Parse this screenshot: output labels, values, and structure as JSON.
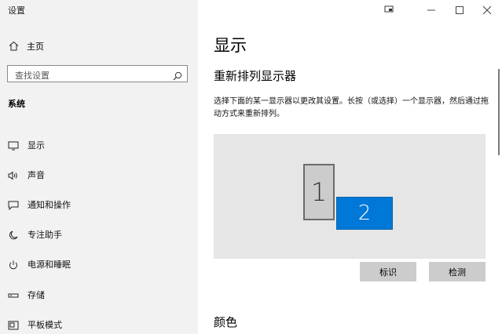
{
  "window": {
    "title": "设置"
  },
  "sidebar": {
    "home_label": "主页",
    "search_placeholder": "查找设置",
    "section_title": "系统",
    "items": [
      {
        "label": "显示",
        "icon": "monitor-icon"
      },
      {
        "label": "声音",
        "icon": "speaker-icon"
      },
      {
        "label": "通知和操作",
        "icon": "notification-icon"
      },
      {
        "label": "专注助手",
        "icon": "moon-icon"
      },
      {
        "label": "电源和睡眠",
        "icon": "power-icon"
      },
      {
        "label": "存储",
        "icon": "storage-icon"
      },
      {
        "label": "平板模式",
        "icon": "tablet-mode-icon"
      }
    ]
  },
  "main": {
    "title": "显示",
    "subheading": "重新排列显示器",
    "description": "选择下面的某一显示器以更改其设置。长按（或选择）一个显示器，然后通过拖动方式来重新排列。",
    "monitors": [
      {
        "label": "1"
      },
      {
        "label": "2",
        "selected": true
      }
    ],
    "identify_label": "标识",
    "detect_label": "检测",
    "color_heading": "颜色"
  },
  "colors": {
    "accent": "#0078d7",
    "sidebar_bg": "#f2f2f2",
    "monitor_area_bg": "#e6e6e6"
  }
}
